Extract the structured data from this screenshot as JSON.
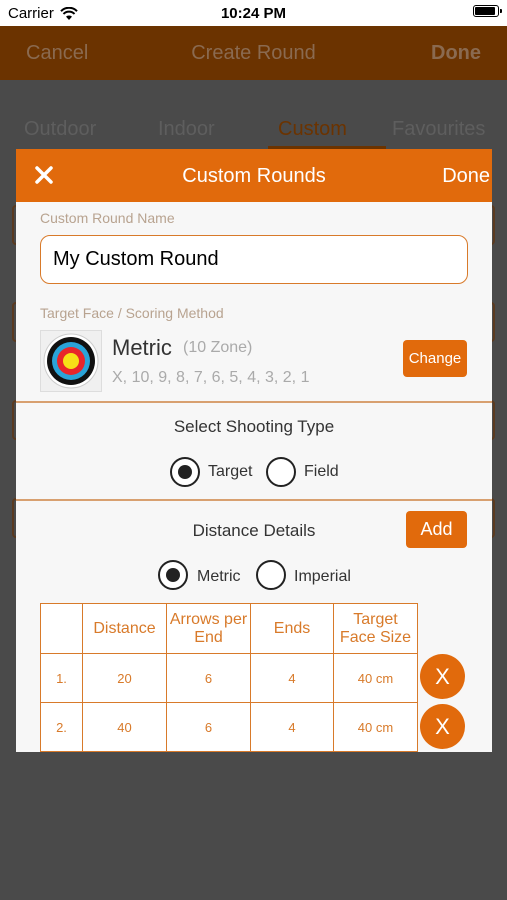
{
  "status_bar": {
    "carrier": "Carrier",
    "time": "10:24 PM"
  },
  "background": {
    "nav": {
      "cancel": "Cancel",
      "title": "Create Round",
      "done": "Done"
    },
    "tabs": [
      "Outdoor",
      "Indoor",
      "Custom",
      "Favourites"
    ],
    "selected_tab": "Custom"
  },
  "modal": {
    "title": "Custom Rounds",
    "done_label": "Done",
    "close_icon": "close-icon",
    "name_label": "Custom Round Name",
    "name_value": "My Custom Round",
    "target_label": "Target Face / Scoring Method",
    "target_face_icon": "archery-target-icon",
    "metric_title": "Metric",
    "metric_zone": "(10 Zone)",
    "metric_scores": "X, 10, 9, 8, 7, 6, 5, 4, 3, 2, 1",
    "change_label": "Change",
    "shooting_type_title": "Select Shooting Type",
    "shooting_types": [
      {
        "label": "Target",
        "selected": true
      },
      {
        "label": "Field",
        "selected": false
      }
    ],
    "distance_title": "Distance Details",
    "add_label": "Add",
    "units": [
      {
        "label": "Metric",
        "selected": true
      },
      {
        "label": "Imperial",
        "selected": false
      }
    ],
    "table": {
      "headers": [
        "",
        "Distance",
        "Arrows per End",
        "Ends",
        "Target Face Size"
      ],
      "rows": [
        {
          "index": "1.",
          "distance": "20",
          "arrows": "6",
          "ends": "4",
          "face": "40 cm"
        },
        {
          "index": "2.",
          "distance": "40",
          "arrows": "6",
          "ends": "4",
          "face": "40 cm"
        }
      ],
      "delete_label": "X"
    }
  },
  "colors": {
    "accent": "#e16a0c",
    "accent_dark": "#6b3300",
    "overlay": "#4a4a4a"
  }
}
